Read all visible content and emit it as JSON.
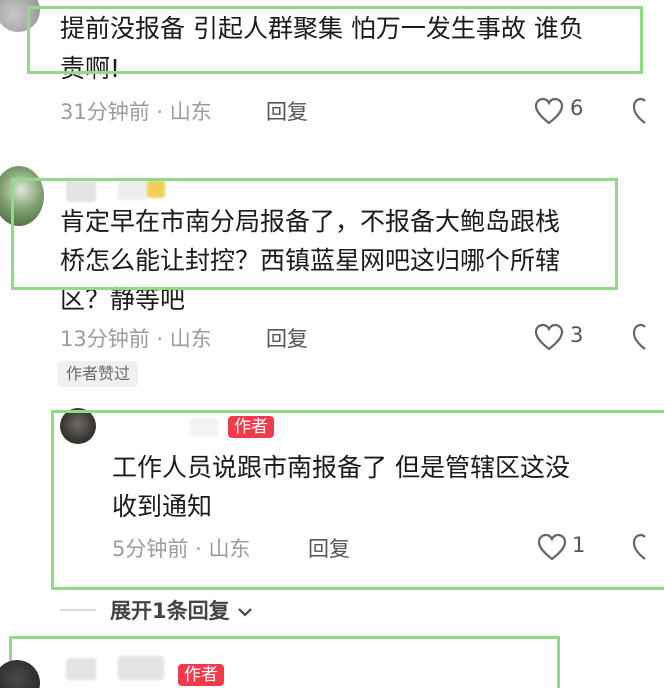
{
  "colors": {
    "highlight_box": "#8fdc84",
    "author_tag": "#f23a4c",
    "meta_text": "#9c9c9c"
  },
  "comments": [
    {
      "text_lines": [
        "提前没报备 引起人群聚集 怕万一发生事故 谁负",
        "责啊!"
      ],
      "time": "31分钟前",
      "location": "山东",
      "reply_label": "回复",
      "likes": "6"
    },
    {
      "text_lines": [
        "肯定早在市南分局报备了，不报备大鲍岛跟栈",
        "桥怎么能让封控？西镇蓝星网吧这归哪个所辖",
        "区？静等吧"
      ],
      "time": "13分钟前",
      "location": "山东",
      "reply_label": "回复",
      "likes": "3",
      "liked_by_author_label": "作者赞过"
    },
    {
      "author_tag": "作者",
      "text_lines": [
        "工作人员说跟市南报备了 但是管辖区这没",
        "收到通知"
      ],
      "time": "5分钟前",
      "location": "山东",
      "reply_label": "回复",
      "likes": "1"
    },
    {
      "author_tag": "作者"
    }
  ],
  "expand_replies_label": "展开1条回复",
  "separator_dot": "·"
}
